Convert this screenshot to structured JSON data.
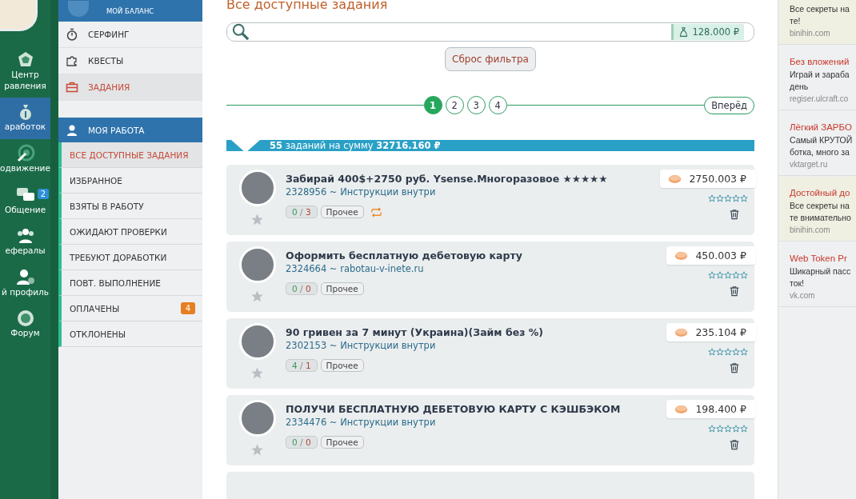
{
  "rail": {
    "items": [
      {
        "label": "Центр",
        "label2": "равления",
        "selected": false
      },
      {
        "label": "аработок",
        "selected": true
      },
      {
        "label": "одвижение",
        "selected": false
      },
      {
        "label": "Общение",
        "selected": false,
        "badge": "2"
      },
      {
        "label": "ефералы",
        "selected": false
      },
      {
        "label": "й профиль",
        "selected": false
      },
      {
        "label": "Форум",
        "selected": false
      }
    ]
  },
  "submenu": {
    "balance_label": "МОЙ БАЛАНС",
    "items": [
      {
        "label": "СЕРФИНГ",
        "selected": false
      },
      {
        "label": "КВЕСТЫ",
        "selected": false
      },
      {
        "label": "ЗАДАНИЯ",
        "selected": true
      }
    ],
    "work_header": "МОЯ РАБОТА",
    "work_items": [
      {
        "label": "ВСЕ ДОСТУПНЫЕ ЗАДАНИЯ",
        "selected": true
      },
      {
        "label": "ИЗБРАННОЕ",
        "selected": false
      },
      {
        "label": "ВЗЯТЫ В РАБОТУ",
        "selected": false
      },
      {
        "label": "ОЖИДАЮТ ПРОВЕРКИ",
        "selected": false
      },
      {
        "label": "ТРЕБУЮТ ДОРАБОТКИ",
        "selected": false
      },
      {
        "label": "ПОВТ. ВЫПОЛНЕНИЕ",
        "selected": false
      },
      {
        "label": "ОПЛАЧЕНЫ",
        "selected": false,
        "badge": "4"
      },
      {
        "label": "ОТКЛОНЕНЫ",
        "selected": false
      }
    ]
  },
  "main": {
    "title": "Все доступные задания",
    "search": {
      "balance": "128.000 ₽"
    },
    "reset_button": "Сброс фильтра",
    "pages": [
      {
        "label": "1",
        "selected": true
      },
      {
        "label": "2",
        "selected": false
      },
      {
        "label": "3",
        "selected": false
      },
      {
        "label": "4",
        "selected": false
      }
    ],
    "next_button": "Вперёд",
    "summary": "**55** заданий на сумму **32716.160 ₽**",
    "tasks": [
      {
        "title": "Забирай 400$+2750 руб. Ysense.Многоразовое ★★★★★",
        "meta": "2328956 ~ Инструкции внутри",
        "done": "0",
        "separator": "/",
        "rejected": "3",
        "category": "Прочее",
        "repeat": true,
        "favorite": false,
        "price": "2750.003 ₽",
        "stars": 0
      },
      {
        "title": "Оформить бесплатную дебетовую карту",
        "meta": "2324664 ~ rabotau-v-inete.ru",
        "done": "0",
        "separator": "/",
        "rejected": "0",
        "category": "Прочее",
        "repeat": false,
        "favorite": false,
        "price": "450.003 ₽",
        "stars": 0
      },
      {
        "title": "90 гривен за 7 минут (Украина)(Займ без %)",
        "meta": "2302153 ~ Инструкции внутри",
        "done": "4",
        "separator": "/",
        "rejected": "1",
        "category": "Прочее",
        "repeat": false,
        "favorite": false,
        "price": "235.104 ₽",
        "stars": 0
      },
      {
        "title": "ПОЛУЧИ БЕСПЛАТНУЮ ДЕБЕТОВУЮ КАРТУ С КЭШБЭКОМ",
        "meta": "2334476 ~ Инструкции внутри",
        "done": "0",
        "separator": "/",
        "rejected": "0",
        "category": "Прочее",
        "repeat": false,
        "favorite": false,
        "price": "198.400 ₽",
        "stars": 0
      }
    ]
  },
  "ads": [
    {
      "lines": [
        "Все секреты на",
        "те!"
      ],
      "domain": "binihin.com",
      "highlighted": true
    },
    {
      "title": "Без вложений",
      "lines": [
        "Играй и зараба",
        "день"
      ],
      "domain": "regiser.ulcraft.co",
      "highlighted": false
    },
    {
      "title": "Лёгкий ЗАРБО",
      "lines": [
        "Самый КРУТОЙ",
        "ботка, много за"
      ],
      "domain": "vktarget.ru",
      "highlighted": false
    },
    {
      "title": "Достойный до",
      "lines": [
        "Все секреты на",
        "те внимательно"
      ],
      "domain": "binihin.com",
      "highlighted": true
    },
    {
      "title": "Web Token Pr",
      "lines": [
        "Шикарный пасс",
        "ток!"
      ],
      "domain": "vk.com",
      "highlighted": false
    }
  ]
}
